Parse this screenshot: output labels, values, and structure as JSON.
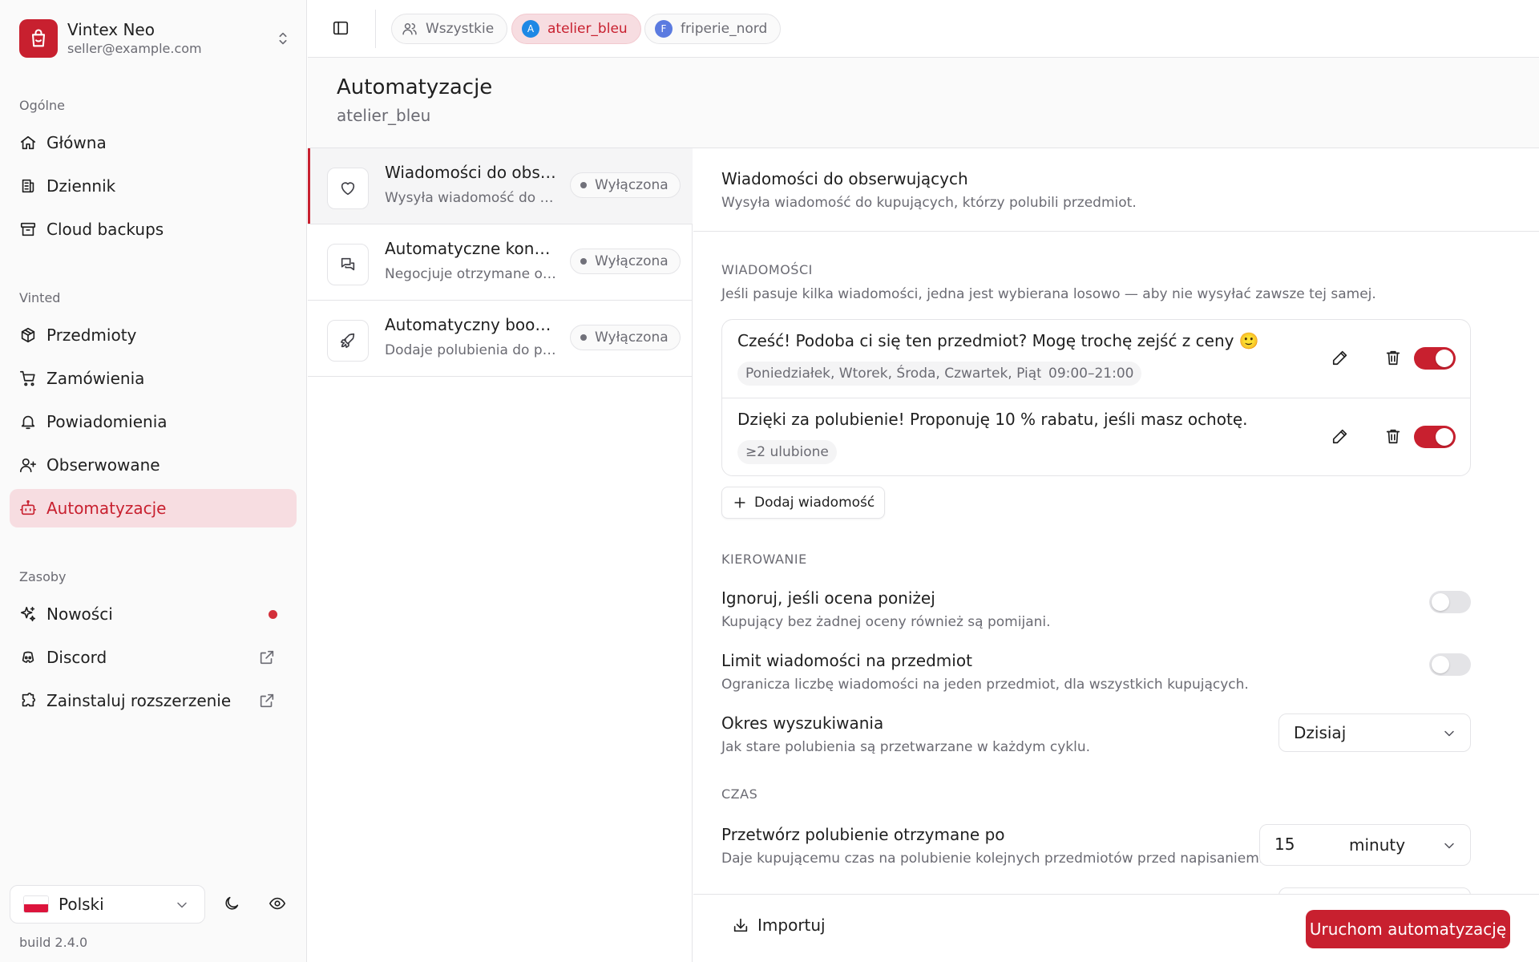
{
  "account": {
    "name": "Vintex Neo",
    "email": "seller@example.com"
  },
  "sidebar": {
    "sections": [
      {
        "label": "Ogólne",
        "items": [
          {
            "label": "Główna",
            "icon": "home-icon"
          },
          {
            "label": "Dziennik",
            "icon": "log-icon"
          },
          {
            "label": "Cloud backups",
            "icon": "archive-icon"
          }
        ]
      },
      {
        "label": "Vinted",
        "items": [
          {
            "label": "Przedmioty",
            "icon": "package-icon"
          },
          {
            "label": "Zamówienia",
            "icon": "cart-icon"
          },
          {
            "label": "Powiadomienia",
            "icon": "bell-icon"
          },
          {
            "label": "Obserwowane",
            "icon": "user-plus-icon"
          },
          {
            "label": "Automatyzacje",
            "icon": "bot-icon",
            "active": true
          }
        ]
      },
      {
        "label": "Zasoby",
        "items": [
          {
            "label": "Nowości",
            "icon": "sparkles-icon",
            "badge": "red-dot"
          },
          {
            "label": "Discord",
            "icon": "discord-icon",
            "external": true
          },
          {
            "label": "Zainstaluj rozszerzenie",
            "icon": "puzzle-icon",
            "external": true
          }
        ]
      }
    ],
    "language": "Polski",
    "build": "build 2.4.0"
  },
  "topbar": {
    "chips": [
      {
        "label": "Wszystkie",
        "icon": "users-icon"
      },
      {
        "label": "atelier_bleu",
        "avatar": "A",
        "avatar_color": "#1e88e5",
        "active": true
      },
      {
        "label": "friperie_nord",
        "avatar": "F",
        "avatar_color": "#5b7be0"
      }
    ]
  },
  "page": {
    "title": "Automatyzacje",
    "subtitle": "atelier_bleu"
  },
  "automations": [
    {
      "title": "Wiadomości do obserwujących",
      "desc": "Wysyła wiadomość do kupujących, którzy polubili przedmiot.",
      "status": "Wyłączona",
      "icon": "heart-icon",
      "selected": true
    },
    {
      "title": "Automatyczne konwersacje",
      "desc": "Negocjuje otrzymane oferty",
      "status": "Wyłączona",
      "icon": "messages-icon"
    },
    {
      "title": "Automatyczny boost polubień",
      "desc": "Dodaje polubienia do przedmiotów",
      "status": "Wyłączona",
      "icon": "rocket-icon"
    }
  ],
  "detail": {
    "title": "Wiadomości do obserwujących",
    "subtitle": "Wysyła wiadomość do kupujących, którzy polubili przedmiot.",
    "messages_section": {
      "label": "WIADOMOŚCI",
      "hint": "Jeśli pasuje kilka wiadomości, jedna jest wybierana losowo — aby nie wysyłać zawsze tej samej.",
      "messages": [
        {
          "text": "Cześć! Podoba ci się ten przedmiot? Mogę trochę zejść z ceny 🙂",
          "tags": [
            "Poniedziałek, Wtorek, Środa, Czwartek, Piątek",
            "09:00–21:00"
          ],
          "enabled": true
        },
        {
          "text": "Dzięki za polubienie! Proponuję 10 % rabatu, jeśli masz ochotę.",
          "tags": [
            "≥2 ulubione"
          ],
          "enabled": true
        }
      ],
      "add_label": "Dodaj wiadomość"
    },
    "targeting": {
      "label": "KIEROWANIE",
      "rows": [
        {
          "title": "Ignoruj, jeśli ocena poniżej",
          "desc": "Kupujący bez żadnej oceny również są pomijani.",
          "enabled": false
        },
        {
          "title": "Limit wiadomości na przedmiot",
          "desc": "Ogranicza liczbę wiadomości na jeden przedmiot, dla wszystkich kupujących.",
          "enabled": false
        }
      ],
      "period": {
        "title": "Okres wyszukiwania",
        "desc": "Jak stare polubienia są przetwarzane w każdym cyklu.",
        "value": "Dzisiaj"
      }
    },
    "timing": {
      "label": "CZAS",
      "delay": {
        "title": "Przetwórz polubienie otrzymane po",
        "desc": "Daje kupującemu czas na polubienie kolejnych przedmiotów przed napisaniem.",
        "value": "15",
        "unit": "minuty"
      }
    }
  },
  "footer": {
    "import_label": "Importuj",
    "run_label": "Uruchom automatyzację"
  },
  "colors": {
    "accent": "#c8202f",
    "accent_soft": "#f7dde1"
  }
}
